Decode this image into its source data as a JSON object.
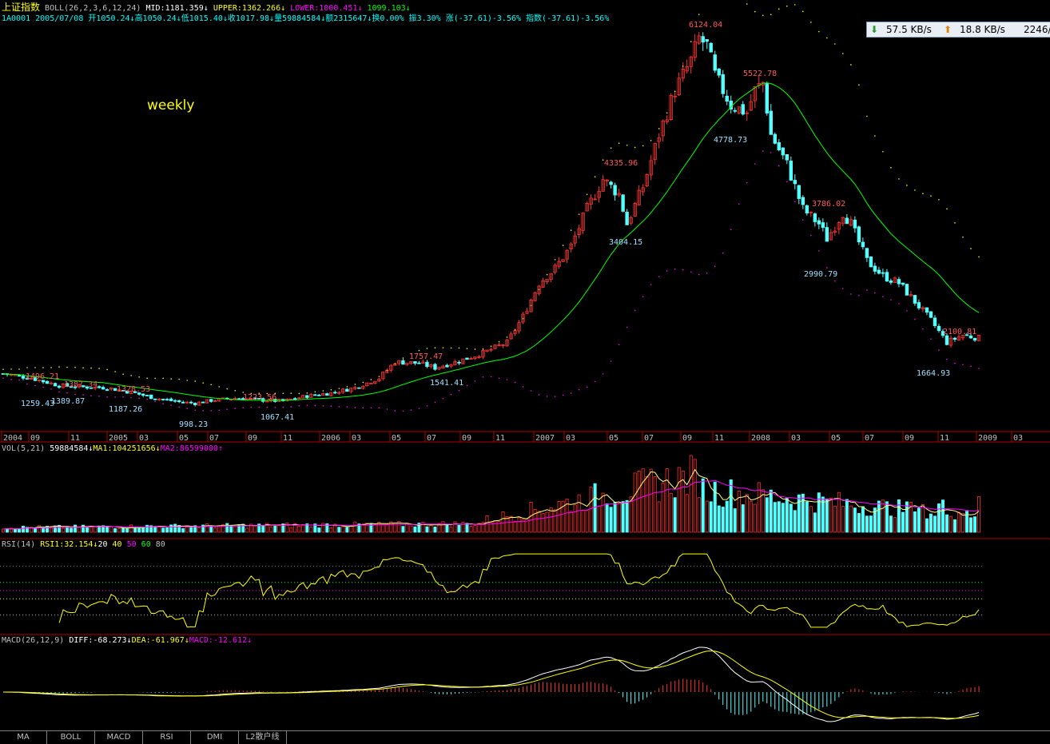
{
  "header": {
    "index_name": "上证指数",
    "boll_params": "BOLL(26,2,3,6,12,24)",
    "mid": "MID:1181.359↓",
    "upper": "UPPER:1362.266↓",
    "lower": "LOWER:1000.451↓",
    "extra": "1099.103↓",
    "line2_date": "1A0001 2005/07/08",
    "line2_open": "开1050.24↓",
    "line2_high": "高1050.24↓",
    "line2_low": "低1015.40↓",
    "line2_close": "收1017.98↓",
    "line2_vol": "量59884584↓",
    "line2_amount": "额2315647↓",
    "line2_turn": "换0.00%",
    "line2_amp": "振3.30%",
    "line2_chg": "涨(-37.61)-3.56%",
    "line2_idx": "指数(-37.61)-3.56%"
  },
  "network": {
    "down": "57.5 KB/s",
    "up": "18.8 KB/s",
    "extra": "2246/6"
  },
  "annotation": "weekly",
  "time_axis": [
    "2004",
    "09",
    "11",
    "2005",
    "03",
    "05",
    "07",
    "09",
    "11",
    "2006",
    "03",
    "05",
    "07",
    "09",
    "11",
    "2007",
    "03",
    "05",
    "07",
    "09",
    "11",
    "2008",
    "03",
    "05",
    "07",
    "09",
    "11",
    "2009",
    "03"
  ],
  "price_labels": [
    "6124.04",
    "5522.78",
    "4778.73",
    "4335.96",
    "3404.15",
    "3786.02",
    "2990.79",
    "2100.81",
    "1664.93",
    "1757.47",
    "1541.41",
    "1496.21",
    "1259.43",
    "1389.87",
    "1387.34",
    "1328.53",
    "1187.26",
    "998.23",
    "1223.56",
    "1067.41"
  ],
  "vol_panel": {
    "title": "VOL(5,21)",
    "value": "59884584↓",
    "ma1": "MA1:104251656↓",
    "ma2": "MA2:86599000↑"
  },
  "rsi_panel": {
    "title": "RSI(14)",
    "rsi1": "RSI1:32.154↓",
    "l20": "20",
    "l40": "40",
    "l50": "50",
    "l60": "60",
    "l80": "80"
  },
  "macd_panel": {
    "title": "MACD(26,12,9)",
    "diff": "DIFF:-68.273↓",
    "dea": "DEA:-61.967↓",
    "macd": "MACD:-12.612↓"
  },
  "tabs": [
    "MA",
    "BOLL",
    "MACD",
    "RSI",
    "DMI",
    "L2散户线"
  ],
  "colors": {
    "up": "#ff3232",
    "down": "#54ffff",
    "mid": "#00ff00",
    "upper": "#ffff00",
    "lower": "#ff00ff",
    "axis": "#b00000"
  },
  "chart_data": {
    "type": "candlestick",
    "title": "上证指数 weekly",
    "x": [
      "2004",
      "2004-09",
      "2004-11",
      "2005",
      "2005-03",
      "2005-05",
      "2005-07",
      "2005-09",
      "2005-11",
      "2006",
      "2006-03",
      "2006-05",
      "2006-07",
      "2006-09",
      "2006-11",
      "2007",
      "2007-03",
      "2007-05",
      "2007-07",
      "2007-09",
      "2007-11",
      "2008",
      "2008-03",
      "2008-05",
      "2008-07",
      "2008-09",
      "2008-11",
      "2009"
    ],
    "close_series": [
      1480,
      1340,
      1280,
      1250,
      1200,
      1080,
      1020,
      1120,
      1110,
      1180,
      1290,
      1480,
      1640,
      1630,
      1850,
      2680,
      3000,
      4000,
      4300,
      5200,
      5500,
      4800,
      3900,
      3600,
      2800,
      2300,
      1900,
      1850
    ],
    "extremes": {
      "max": 6124.04,
      "min": 998.23
    },
    "ylim": [
      700,
      6300
    ]
  }
}
